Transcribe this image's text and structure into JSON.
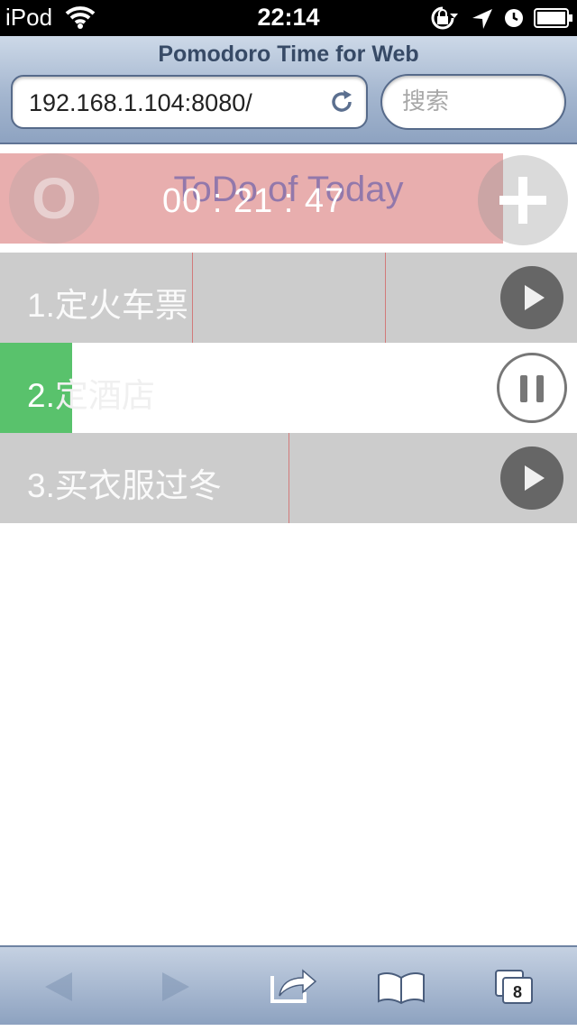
{
  "status": {
    "carrier": "iPod",
    "time": "22:14"
  },
  "browser": {
    "page_title": "Pomodoro Time for Web",
    "url": "192.168.1.104:8080/",
    "search_placeholder": "搜索",
    "tab_count": "8"
  },
  "app": {
    "header_title": "ToDo of Today",
    "timer": "00 : 21 : 47",
    "start_badge": "O",
    "tasks": [
      {
        "label": "1.定火车票",
        "state": "play"
      },
      {
        "label_lead": "2.",
        "label_rest": "定酒店",
        "state": "pause",
        "progress_percent": 12.5
      },
      {
        "label": "3.买衣服过冬",
        "state": "play"
      }
    ]
  },
  "colors": {
    "active_timer": "#e8aeae",
    "task_bg": "#cccccc",
    "progress_green": "#59c26c",
    "divider": "#d27a7a"
  }
}
